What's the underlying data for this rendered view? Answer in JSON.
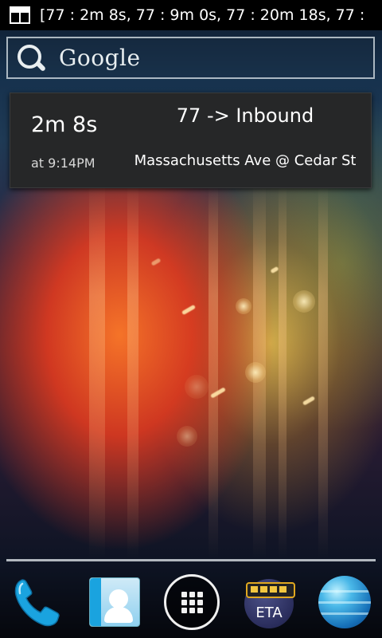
{
  "status_bar": {
    "notification_icon": "widget-notification-icon",
    "ticker_text": "[77 : 2m 8s, 77 : 9m 0s, 77 : 20m 18s, 77 :"
  },
  "search": {
    "icon": "search-icon",
    "label": "Google"
  },
  "eta_widget": {
    "countdown": "2m 8s",
    "arrival_time": "at 9:14PM",
    "route_direction": "77 -> Inbound",
    "stop_name": "Massachusetts Ave @ Cedar St"
  },
  "dock": {
    "items": [
      {
        "name": "Phone",
        "icon": "phone-icon"
      },
      {
        "name": "People",
        "icon": "contacts-icon"
      },
      {
        "name": "Apps",
        "icon": "app-drawer-icon"
      },
      {
        "name": "ETA",
        "icon": "bus-icon",
        "label": "ETA"
      },
      {
        "name": "Browser",
        "icon": "globe-icon"
      }
    ]
  },
  "colors": {
    "status_bar_bg": "#000000",
    "widget_bg": "#262728",
    "text": "#ffffff",
    "accent_phone": "#1aa3df"
  }
}
